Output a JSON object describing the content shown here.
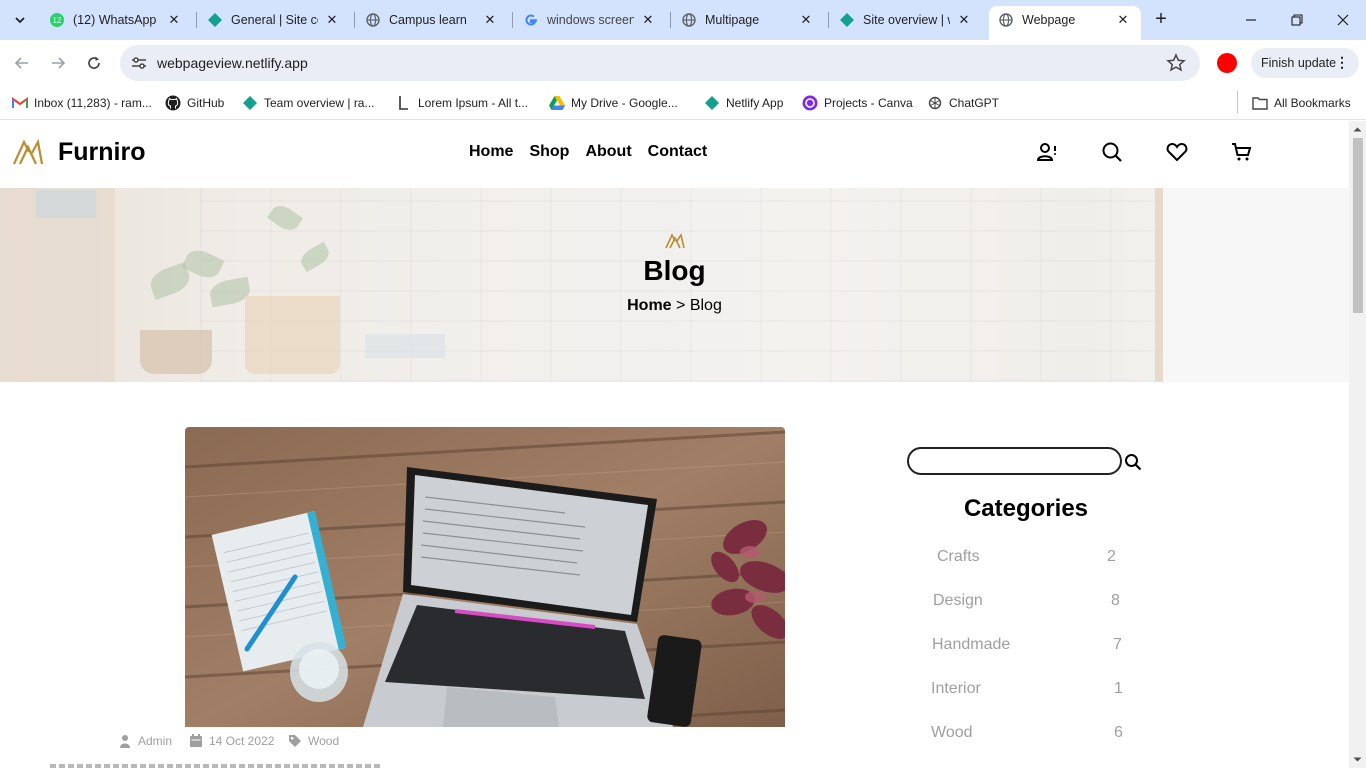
{
  "browser": {
    "tabs": [
      {
        "title": "(12) WhatsApp",
        "icon": "whatsapp-icon"
      },
      {
        "title": "General | Site co",
        "icon": "netlify-icon"
      },
      {
        "title": "Campus learn",
        "icon": "globe-icon"
      },
      {
        "title": "windows screens",
        "icon": "google-icon"
      },
      {
        "title": "Multipage",
        "icon": "globe-icon"
      },
      {
        "title": "Site overview | w",
        "icon": "netlify-icon"
      },
      {
        "title": "Webpage",
        "icon": "globe-icon",
        "active": true
      }
    ],
    "whatsapp_badge": "12",
    "url": "webpageview.netlify.app",
    "finish_update_label": "Finish update",
    "bookmarks": [
      {
        "label": "Inbox (11,283) - ram...",
        "icon": "gmail-icon"
      },
      {
        "label": "GitHub",
        "icon": "github-icon"
      },
      {
        "label": "Team overview | ra...",
        "icon": "netlify-icon"
      },
      {
        "label": "Lorem Ipsum - All t...",
        "icon": "lorem-icon"
      },
      {
        "label": "My Drive - Google...",
        "icon": "google-drive-icon"
      },
      {
        "label": "Netlify App",
        "icon": "netlify-icon"
      },
      {
        "label": "Projects - Canva",
        "icon": "canva-icon"
      },
      {
        "label": "ChatGPT",
        "icon": "chatgpt-icon"
      }
    ],
    "all_bookmarks_label": "All Bookmarks"
  },
  "site": {
    "brand": "Furniro",
    "nav": [
      "Home",
      "Shop",
      "About",
      "Contact"
    ],
    "banner": {
      "title": "Blog",
      "breadcrumb_home": "Home",
      "breadcrumb_sep": ">",
      "breadcrumb_current": "Blog"
    },
    "post": {
      "author": "Admin",
      "date": "14 Oct 2022",
      "tag": "Wood"
    },
    "sidebar": {
      "search_placeholder": "",
      "categories_title": "Categories",
      "categories": [
        {
          "name": "Crafts",
          "count": "2"
        },
        {
          "name": "Design",
          "count": "8"
        },
        {
          "name": "Handmade",
          "count": "7"
        },
        {
          "name": "Interior",
          "count": "1"
        },
        {
          "name": "Wood",
          "count": "6"
        }
      ]
    }
  },
  "colors": {
    "brand_gold": "#b88e2f",
    "tabbar_bg": "#d3e3fd",
    "muted_text": "#9f9f9f"
  }
}
